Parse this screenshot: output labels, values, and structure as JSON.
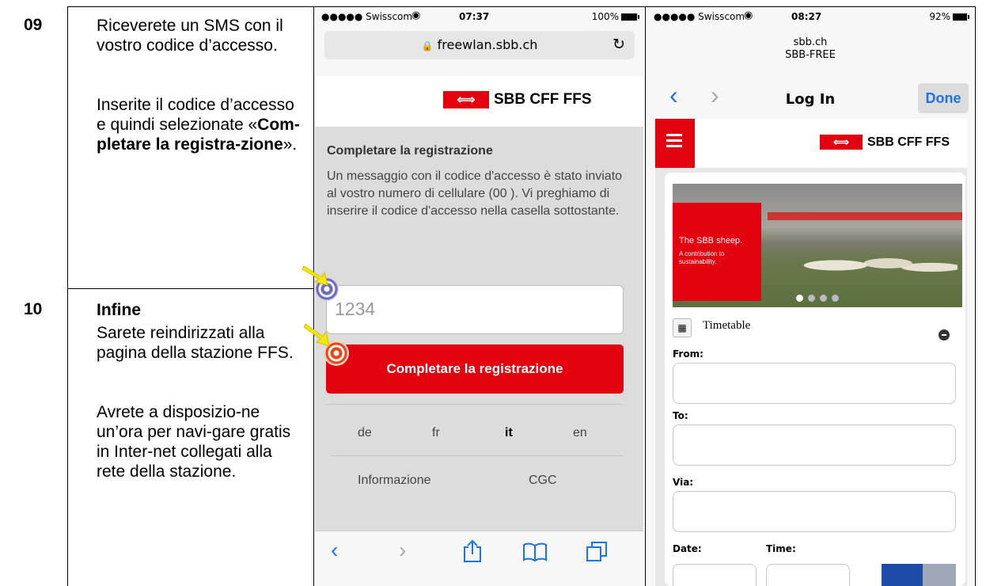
{
  "steps": [
    {
      "number": "09",
      "paragraphs": [
        "Riceverete un SMS con il vostro codice d’accesso."
      ],
      "instr_pre": "Inserite il codice d’accesso e quindi selezionate «",
      "instr_bold": "Com-pletare la registra-zione",
      "instr_post": "»."
    },
    {
      "number": "10",
      "heading": "Infine",
      "paragraphs": [
        "Sarete reindirizzati alla pagina della stazione FFS.",
        "Avrete a disposizio-ne un’ora per navi-gare gratis in Inter-net collegati alla rete della stazione."
      ]
    }
  ],
  "phone1": {
    "carrier": "●●●●● Swisscom",
    "time": "07:37",
    "battery": "100%",
    "url": "freewlan.sbb.ch",
    "logo": "SBB CFF FFS",
    "form_title": "Completare la registrazione",
    "message": "Un messaggio con il codice d'accesso è stato inviato al vostro numero di cellulare (00                    ). Vi preghiamo di inserire il codice d'accesso nella casella sottostante.",
    "code_placeholder": "1234",
    "submit_label": "Completare la registrazione",
    "languages": [
      "de",
      "fr",
      "it",
      "en"
    ],
    "active_language": "it",
    "footer_links": [
      "Informazione",
      "CGC"
    ],
    "toolbar_icons": [
      "back-icon",
      "forward-icon",
      "share-icon",
      "bookmarks-icon",
      "tabs-icon"
    ]
  },
  "phone2": {
    "carrier": "●●●●● Swisscom",
    "time": "08:27",
    "battery": "92%",
    "domain": "sbb.ch",
    "network": "SBB-FREE",
    "nav_title": "Log In",
    "done_label": "Done",
    "logo": "SBB CFF FFS",
    "banner_title": "The SBB sheep.",
    "banner_sub": "A contribution to sustainability.",
    "section_title": "Timetable",
    "labels": {
      "from": "From:",
      "to": "To:",
      "via": "Via:",
      "date": "Date:",
      "time": "Time:"
    }
  },
  "colors": {
    "sbb_red": "#e3000f",
    "ios_blue": "#1a73e8",
    "grey_bg": "#dcdcdc"
  }
}
